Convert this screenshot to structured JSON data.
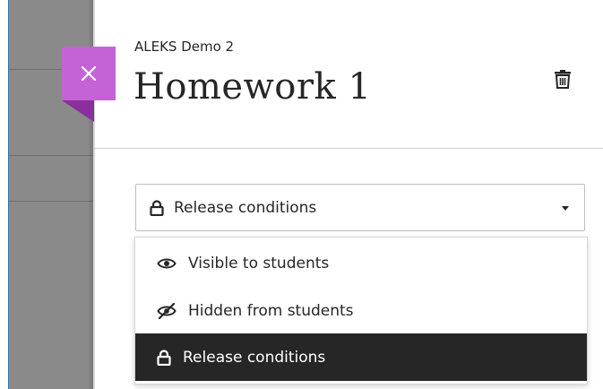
{
  "panel": {
    "course_name": "ALEKS Demo 2",
    "title": "Homework 1",
    "close_label": "Close",
    "delete_label": "Delete"
  },
  "visibility": {
    "selected_label": "Release conditions",
    "options": [
      {
        "label": "Visible to students",
        "icon": "eye-icon"
      },
      {
        "label": "Hidden from students",
        "icon": "eye-slash-icon"
      },
      {
        "label": "Release conditions",
        "icon": "lock-icon",
        "selected": true
      }
    ]
  },
  "colors": {
    "close_tab": "#c463d6",
    "close_tab_fold": "#8a2f9d",
    "selected_item_bg": "#262626",
    "backdrop": "#8a8a8a"
  }
}
